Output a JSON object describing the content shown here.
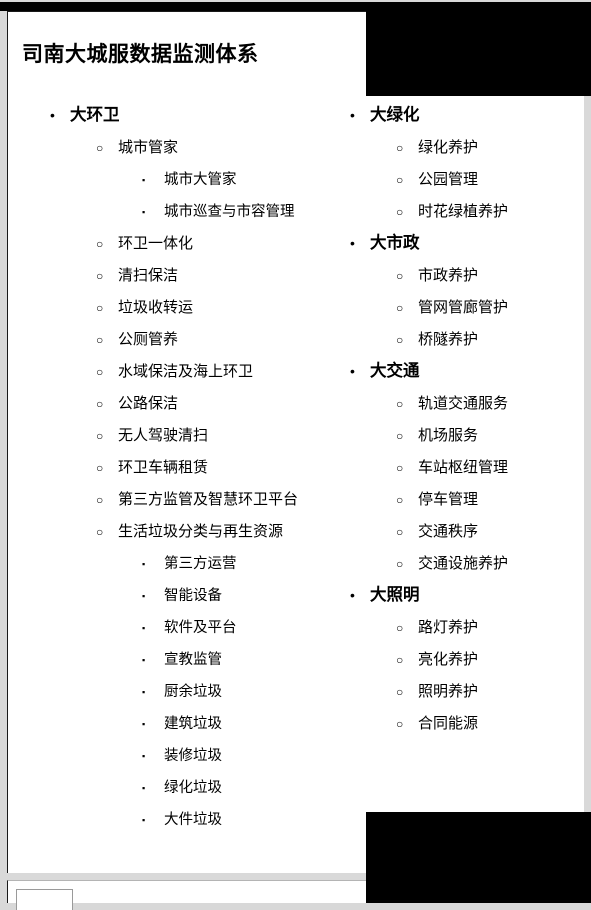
{
  "document": {
    "title": "司南大城服数据监测体系",
    "bullets": {
      "level1": "•",
      "level2": "○",
      "level3": "▪"
    }
  },
  "left_column": [
    {
      "label": "大环卫",
      "children": [
        {
          "label": "城市管家",
          "children": [
            {
              "label": "城市大管家"
            },
            {
              "label": "城市巡查与市容管理"
            }
          ]
        },
        {
          "label": "环卫一体化"
        },
        {
          "label": "清扫保洁"
        },
        {
          "label": "垃圾收转运"
        },
        {
          "label": "公厕管养"
        },
        {
          "label": "水域保洁及海上环卫"
        },
        {
          "label": "公路保洁"
        },
        {
          "label": "无人驾驶清扫"
        },
        {
          "label": "环卫车辆租赁"
        },
        {
          "label": "第三方监管及智慧环卫平台"
        },
        {
          "label": "生活垃圾分类与再生资源",
          "children": [
            {
              "label": "第三方运营"
            },
            {
              "label": "智能设备"
            },
            {
              "label": "软件及平台"
            },
            {
              "label": "宣教监管"
            },
            {
              "label": "厨余垃圾"
            },
            {
              "label": "建筑垃圾"
            },
            {
              "label": "装修垃圾"
            },
            {
              "label": "绿化垃圾"
            },
            {
              "label": "大件垃圾"
            }
          ]
        }
      ]
    }
  ],
  "right_column": [
    {
      "label": "大绿化",
      "children": [
        {
          "label": "绿化养护"
        },
        {
          "label": "公园管理"
        },
        {
          "label": "时花绿植养护"
        }
      ]
    },
    {
      "label": "大市政",
      "children": [
        {
          "label": "市政养护"
        },
        {
          "label": "管网管廊管护"
        },
        {
          "label": "桥隧养护"
        }
      ]
    },
    {
      "label": "大交通",
      "children": [
        {
          "label": "轨道交通服务"
        },
        {
          "label": "机场服务"
        },
        {
          "label": "车站枢纽管理"
        },
        {
          "label": "停车管理"
        },
        {
          "label": "交通秩序"
        },
        {
          "label": "交通设施养护"
        }
      ]
    },
    {
      "label": "大照明",
      "children": [
        {
          "label": "路灯养护"
        },
        {
          "label": "亮化养护"
        },
        {
          "label": "照明养护"
        },
        {
          "label": "合同能源"
        }
      ]
    }
  ]
}
